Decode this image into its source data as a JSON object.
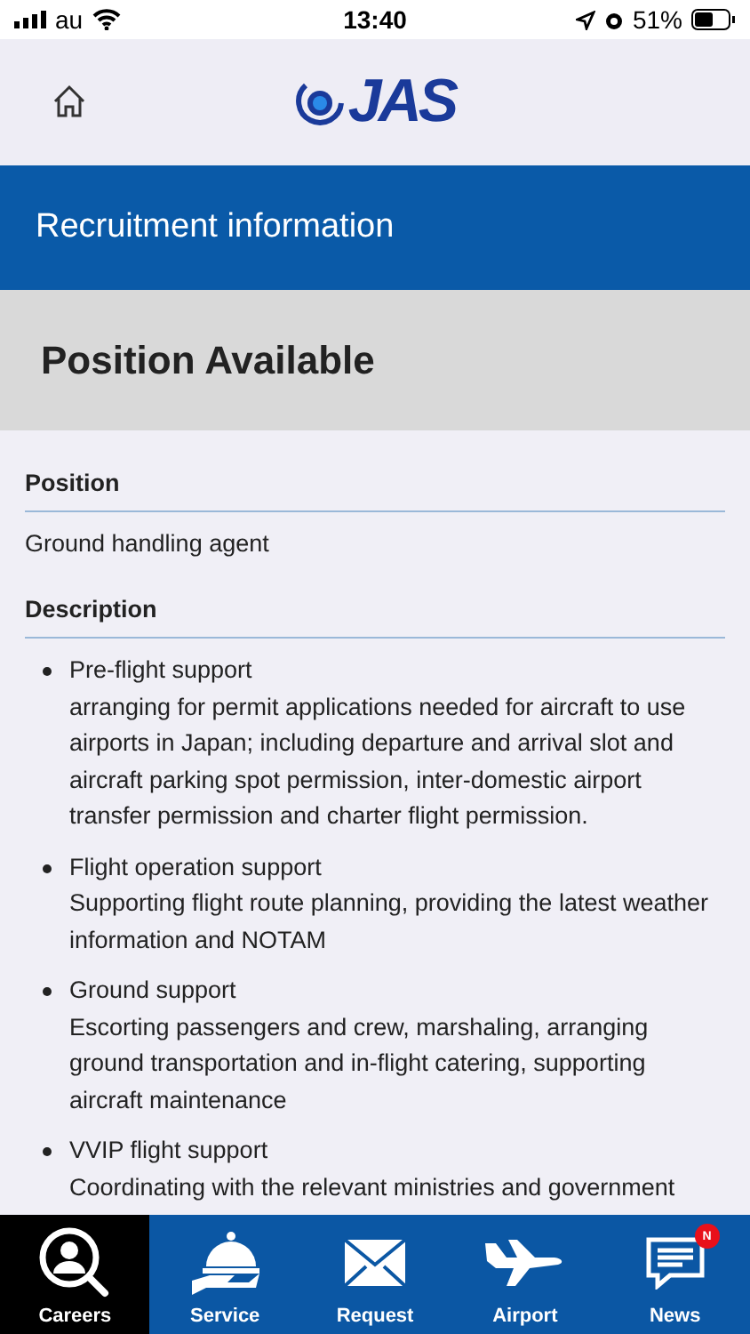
{
  "status_bar": {
    "carrier": "au",
    "time": "13:40",
    "battery": "51%"
  },
  "header": {
    "logo_text": "JAS"
  },
  "banner": {
    "title": "Recruitment information"
  },
  "section": {
    "title": "Position Available"
  },
  "fields": [
    {
      "label": "Position",
      "value": "Ground handling agent"
    }
  ],
  "description": {
    "label": "Description",
    "items": [
      {
        "title": "Pre-flight support",
        "text": "arranging for permit applications needed for aircraft to use airports in Japan; including departure and arrival slot and aircraft parking spot permission, inter-domestic airport transfer permission and charter flight permission."
      },
      {
        "title": "Flight operation support",
        "text": "Supporting flight route planning, providing the latest weather information and NOTAM"
      },
      {
        "title": "Ground support",
        "text": "Escorting passengers and crew, marshaling, arranging ground transportation and in-flight catering, supporting aircraft maintenance"
      },
      {
        "title": "VVIP flight support",
        "text": "Coordinating with the relevant ministries and government"
      }
    ]
  },
  "tabs": [
    {
      "label": "Careers",
      "kind": "careers",
      "selected": true
    },
    {
      "label": "Service",
      "kind": "service",
      "selected": false
    },
    {
      "label": "Request",
      "kind": "request",
      "selected": false
    },
    {
      "label": "Airport",
      "kind": "airport",
      "selected": false
    },
    {
      "label": "News",
      "kind": "news",
      "selected": false,
      "badge": "N"
    }
  ]
}
